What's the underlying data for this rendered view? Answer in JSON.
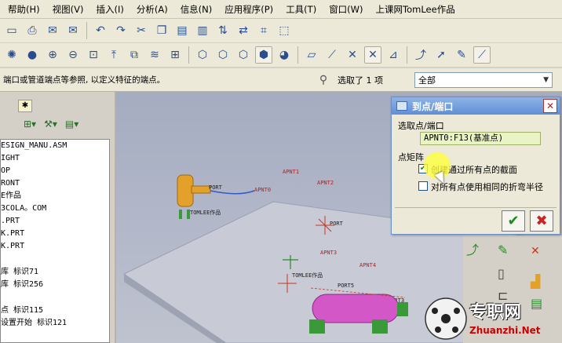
{
  "menubar": {
    "items": [
      "帮助(H)",
      "视图(V)",
      "插入(I)",
      "分析(A)",
      "信息(N)",
      "应用程序(P)",
      "工具(T)",
      "窗口(W)",
      "上课网TomLee作品"
    ]
  },
  "status": {
    "hint": "端口或管道端点等参照, 以定义特征的端点。",
    "selection": "选取了 1 项",
    "filter_value": "全部"
  },
  "model_tree": {
    "items": [
      "ESIGN_MANU.ASM",
      "IGHT",
      "OP",
      "RONT",
      "E作品",
      "3COLA。COM",
      ".PRT",
      "K.PRT",
      "K.PRT",
      "",
      "库 标识71",
      "库 标识256",
      "",
      "点 标识115",
      "设置开始 标识121"
    ]
  },
  "viewport_labels": {
    "apnt0": "APNT0",
    "apnt1": "APNT1",
    "apnt2": "APNT2",
    "apnt3": "APNT3",
    "apnt4": "APNT4",
    "port1": "PORT",
    "port2": "PORT",
    "tomlee1": "TOMLEE作品",
    "tomlee2": "TOMLEE作品",
    "port5": "PORT5",
    "port3": "PORT3"
  },
  "dialog": {
    "title": "到点/端口",
    "select_label": "选取点/端口",
    "field_value": "APNT0:F13(基准点)",
    "section": "点矩阵",
    "check1": "创建通过所有点的截面",
    "check2": "对所有点使用相同的折弯半径",
    "ok": "✔",
    "cancel": "✖"
  },
  "watermark": {
    "cn": "专职网",
    "url": "Zhuanzhi.Net"
  },
  "colors": {
    "dialog_title": "#5f8fd6",
    "field_bg": "#e9f3c4",
    "viewport_bg": "#b4b9ca",
    "pipe_color": "#c84fc0",
    "tank_color": "#e3a02a"
  }
}
